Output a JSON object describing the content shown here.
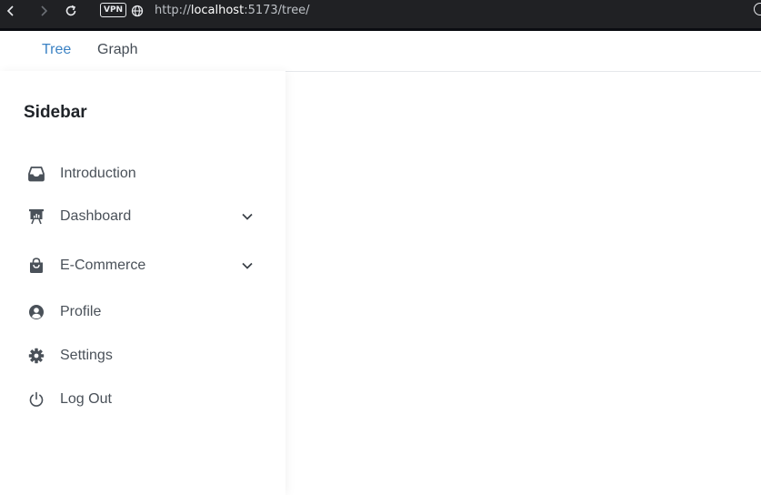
{
  "browser": {
    "url_prefix": "http://",
    "url_host": "localhost",
    "url_rest": ":5173/tree/",
    "vpn_label": "VPN"
  },
  "tabs": [
    {
      "label": "Tree",
      "active": true
    },
    {
      "label": "Graph",
      "active": false
    }
  ],
  "sidebar": {
    "title": "Sidebar",
    "items": [
      {
        "label": "Introduction",
        "icon": "inbox-icon",
        "expandable": false
      },
      {
        "label": "Dashboard",
        "icon": "presentation-chart-icon",
        "expandable": true
      },
      {
        "label": "E-Commerce",
        "icon": "shopping-bag-icon",
        "expandable": true
      },
      {
        "label": "Profile",
        "icon": "user-circle-icon",
        "expandable": false
      },
      {
        "label": "Settings",
        "icon": "gear-icon",
        "expandable": false
      },
      {
        "label": "Log Out",
        "icon": "power-icon",
        "expandable": false
      }
    ]
  },
  "colors": {
    "accent": "#3b82c4",
    "icon": "#4a5159",
    "browser_bg": "#202124"
  }
}
